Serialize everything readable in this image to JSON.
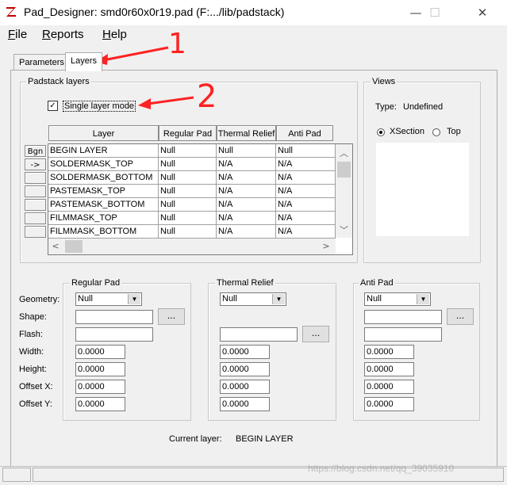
{
  "window": {
    "title": "Pad_Designer: smd0r60x0r19.pad (F:.../lib/padstack)",
    "minimize_glyph": "—",
    "maximize_glyph": "☐",
    "close_glyph": "✕",
    "app_icon": "pad-designer-logo-icon"
  },
  "menu": {
    "file_u": "F",
    "file_rest": "ile",
    "reports_u": "R",
    "reports_rest": "eports",
    "help_u": "H",
    "help_rest": "elp"
  },
  "tabs": [
    {
      "label": "Parameters",
      "active": false
    },
    {
      "label": "Layers",
      "active": true
    }
  ],
  "padstack_layers": {
    "group_label": "Padstack layers",
    "single_layer_mode_label": "Single layer mode",
    "single_layer_mode_checked": true,
    "columns": [
      "Layer",
      "Regular Pad",
      "Thermal Relief",
      "Anti Pad"
    ],
    "row_buttons": [
      "Bgn",
      "->",
      "",
      "",
      "",
      "",
      ""
    ],
    "rows": [
      [
        "BEGIN LAYER",
        "Null",
        "Null",
        "Null"
      ],
      [
        "SOLDERMASK_TOP",
        "Null",
        "N/A",
        "N/A"
      ],
      [
        "SOLDERMASK_BOTTOM",
        "Null",
        "N/A",
        "N/A"
      ],
      [
        "PASTEMASK_TOP",
        "Null",
        "N/A",
        "N/A"
      ],
      [
        "PASTEMASK_BOTTOM",
        "Null",
        "N/A",
        "N/A"
      ],
      [
        "FILMMASK_TOP",
        "Null",
        "N/A",
        "N/A"
      ],
      [
        "FILMMASK_BOTTOM",
        "Null",
        "N/A",
        "N/A"
      ]
    ]
  },
  "views": {
    "group_label": "Views",
    "type_label": "Type:",
    "type_value": "Undefined",
    "xsection_label": "XSection",
    "top_label": "Top",
    "selected": "XSection"
  },
  "field_labels": {
    "geometry": "Geometry:",
    "shape": "Shape:",
    "flash": "Flash:",
    "width": "Width:",
    "height": "Height:",
    "offset_x": "Offset X:",
    "offset_y": "Offset Y:"
  },
  "regular_pad": {
    "label": "Regular Pad",
    "geometry": "Null",
    "shape": "",
    "flash": "",
    "width": "0.0000",
    "height": "0.0000",
    "offset_x": "0.0000",
    "offset_y": "0.0000"
  },
  "thermal_relief": {
    "label": "Thermal Relief",
    "geometry": "Null",
    "flash": "",
    "width": "0.0000",
    "height": "0.0000",
    "offset_x": "0.0000",
    "offset_y": "0.0000"
  },
  "anti_pad": {
    "label": "Anti Pad",
    "geometry": "Null",
    "shape": "",
    "flash": "",
    "width": "0.0000",
    "height": "0.0000",
    "offset_x": "0.0000",
    "offset_y": "0.0000"
  },
  "browse_label": "...",
  "current_layer": {
    "label": "Current layer:",
    "value": "BEGIN LAYER"
  },
  "annotations": {
    "one": "1",
    "two": "2",
    "color": "#ff2222"
  },
  "watermark": "https://blog.csdn.net/qq_39035910"
}
